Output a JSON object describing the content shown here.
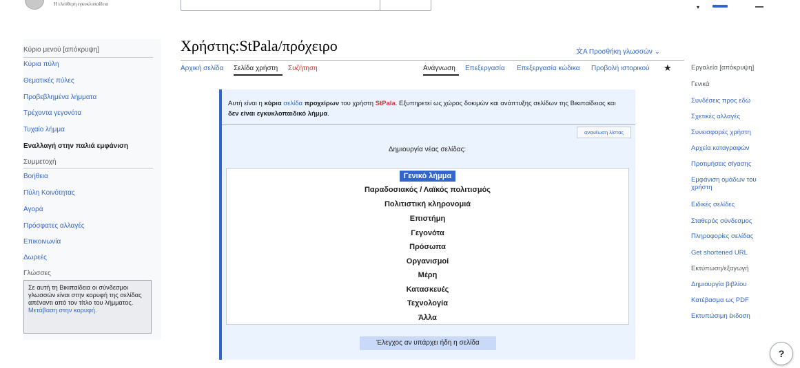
{
  "header": {
    "tagline": "Η ελεύθερη εγκυκλοπαίδεια",
    "dropdown_glyph": "▾"
  },
  "sidebar": {
    "main_menu_label": "Κύριο μενού [απόκρυψη]",
    "items": [
      "Κύρια πύλη",
      "Θεματικές πύλες",
      "Προβεβλημένα λήμματα",
      "Τρέχοντα γεγονότα",
      "Τυχαίο λήμμα"
    ],
    "old_look": "Εναλλαγή στην παλιά εμφάνιση",
    "participation_heading": "Συμμετοχή",
    "participation_items": [
      "Βοήθεια",
      "Πύλη Κοινότητας",
      "Αγορά",
      "Πρόσφατες αλλαγές",
      "Επικοινωνία",
      "Δωρεές"
    ],
    "languages_heading": "Γλώσσες",
    "notice_text": "Σε αυτή τη Βικιπαίδεια οι σύνδεσμοι γλωσσών είναι στην κορυφή της σελίδας απέναντι από τον τίτλο του λήμματος.",
    "notice_link": "Μετάβαση στην κορυφή."
  },
  "page": {
    "title": "Χρήστης:StPala/πρόχειρο",
    "add_languages": "文A Προσθήκη γλωσσών ⌄"
  },
  "tabs": {
    "left": [
      "Αρχική σελίδα",
      "Σελίδα χρήστη",
      "Συζήτηση"
    ],
    "right": [
      "Ανάγνωση",
      "Επεξεργασία",
      "Επεξεργασία κώδικα",
      "Προβολή ιστορικού"
    ],
    "star": "★"
  },
  "content": {
    "intro_1": "Αυτή είναι η ",
    "intro_2": "κύρια",
    "intro_3": "σελίδα",
    "intro_4": "προχείρων",
    "intro_5": " του χρήστη ",
    "intro_user": "StPala",
    "intro_6": ". Εξυπηρετεί ως χώρος δοκιμών και ανάπτυξης σελίδων της Βικιπαίδειας και ",
    "intro_7": "δεν είναι εγκυκλοπαιδικό λήμμα",
    "intro_8": ".",
    "refresh_label": "ανανέωση λίστας",
    "create_heading": "Δημιουργία νέας σελίδας:",
    "types": [
      "Γενικό λήμμα",
      "Παραδοσιακός / Λαϊκός πολιτισμός",
      "Πολιτιστική κληρονομιά",
      "Επιστήμη",
      "Γεγονότα",
      "Πρόσωπα",
      "Οργανισμοί",
      "Μέρη",
      "Κατασκευές",
      "Τεχνολογία",
      "Άλλα"
    ],
    "check_button": "Έλεγχος αν υπάρχει ήδη η σελίδα"
  },
  "tools": {
    "label": "Εργαλεία [απόκρυψη]",
    "general_heading": "Γενικά",
    "items": [
      "Συνδέσεις προς εδώ",
      "Σχετικές αλλαγές",
      "Συνεισφορές χρήστη",
      "Αρχεία καταγραφών",
      "Προτιμήσεις σίγασης",
      "Εμφάνιση ομάδων του χρήστη",
      "Ειδικές σελίδες",
      "Σταθερός σύνδεσμος",
      "Πληροφορίες σελίδας",
      "Get shortened URL"
    ],
    "print_heading": "Εκτύπωση/εξαγωγή",
    "print_items": [
      "Δημιουργία βιβλίου",
      "Κατέβασμα ως PDF",
      "Εκτυπώσιμη έκδοση"
    ]
  },
  "help": {
    "label": "?"
  },
  "colors": {
    "accent": "#3366cc",
    "red_link": "#d73333",
    "box_bg": "#eaf3ff",
    "selected_bg": "#3366cc"
  },
  "icons": {
    "logo": "wikipedia-globe-icon",
    "star": "star-icon",
    "help": "help-icon",
    "translate": "translate-icon"
  }
}
